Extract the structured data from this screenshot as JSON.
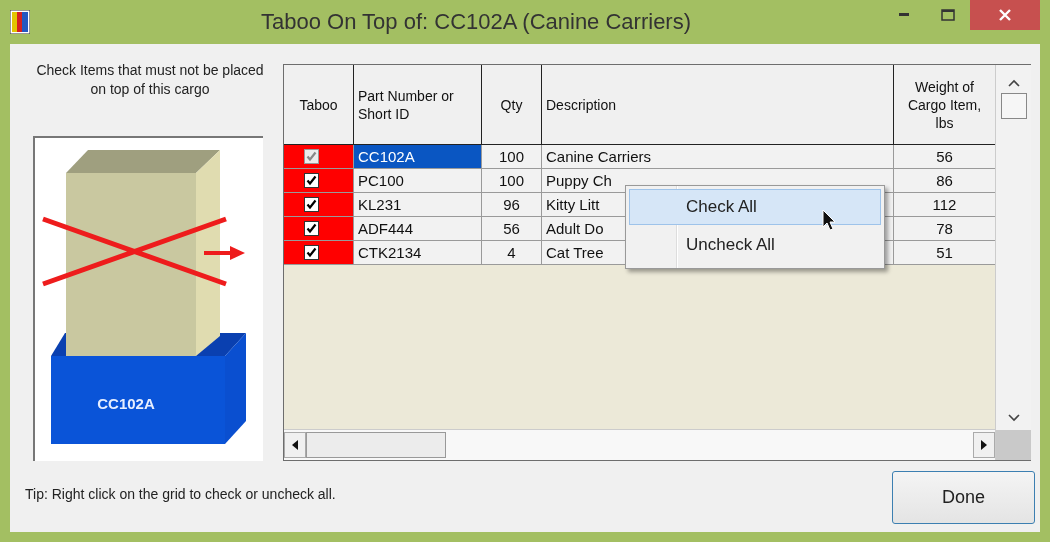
{
  "window": {
    "title": "Taboo On Top of: CC102A (Canine Carriers)"
  },
  "instructions": "Check Items that must not be placed on top of this cargo",
  "preview": {
    "base_label": "CC102A"
  },
  "grid": {
    "columns": [
      "Taboo",
      "Part Number or Short ID",
      "Qty",
      "Description",
      "Weight of Cargo Item, lbs"
    ],
    "rows": [
      {
        "taboo": true,
        "disabled": true,
        "selected": true,
        "part": "CC102A",
        "qty": "100",
        "description": "Canine Carriers",
        "weight": "56"
      },
      {
        "taboo": true,
        "disabled": false,
        "selected": false,
        "part": "PC100",
        "qty": "100",
        "description": "Puppy Ch",
        "weight": "86"
      },
      {
        "taboo": true,
        "disabled": false,
        "selected": false,
        "part": "KL231",
        "qty": "96",
        "description": "Kitty Litt",
        "weight": "112"
      },
      {
        "taboo": true,
        "disabled": false,
        "selected": false,
        "part": "ADF444",
        "qty": "56",
        "description": "Adult Do",
        "weight": "78"
      },
      {
        "taboo": true,
        "disabled": false,
        "selected": false,
        "part": "CTK2134",
        "qty": "4",
        "description": "Cat Tree",
        "weight": "51"
      }
    ]
  },
  "context_menu": {
    "items": [
      {
        "label": "Check All",
        "selected": true
      },
      {
        "label": "Uncheck All",
        "selected": false
      }
    ]
  },
  "tip": "Tip: Right click on the grid to check or uncheck all.",
  "buttons": [
    "Done"
  ]
}
